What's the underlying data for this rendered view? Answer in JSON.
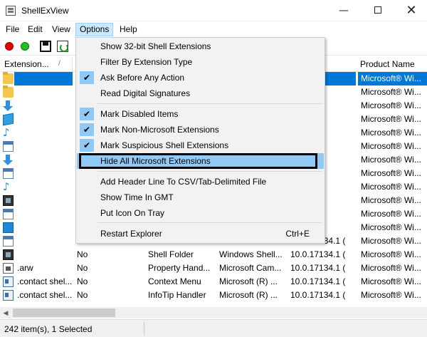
{
  "window": {
    "title": "ShellExView",
    "minimize": "—",
    "close": "✕"
  },
  "menubar": {
    "file": "File",
    "edit": "Edit",
    "view": "View",
    "options": "Options",
    "help": "Help"
  },
  "list": {
    "headers": {
      "extension": "Extension...",
      "sort": "/",
      "product": "Product Name"
    },
    "rows": [
      {
        "icon": "folder-icon",
        "ext": "",
        "disabled": "",
        "type": "",
        "desc": "",
        "ver": "4.1 (",
        "prod": "Microsoft® Wi...",
        "selected": true
      },
      {
        "icon": "folder-icon",
        "ext": "",
        "disabled": "",
        "type": "",
        "desc": "",
        "ver": "4.1 (",
        "prod": "Microsoft® Wi..."
      },
      {
        "icon": "arrow-icon",
        "ext": "",
        "disabled": "",
        "type": "",
        "desc": "",
        "ver": "4.1 (",
        "prod": "Microsoft® Wi..."
      },
      {
        "icon": "cube-icon",
        "ext": "",
        "disabled": "",
        "type": "",
        "desc": "",
        "ver": "4.1 (",
        "prod": "Microsoft® Wi..."
      },
      {
        "icon": "music-note-icon",
        "ext": "",
        "disabled": "",
        "type": "",
        "desc": "",
        "ver": "4.1 (",
        "prod": "Microsoft® Wi..."
      },
      {
        "icon": "window-icon",
        "ext": "",
        "disabled": "",
        "type": "",
        "desc": "",
        "ver": "4.1 (",
        "prod": "Microsoft® Wi..."
      },
      {
        "icon": "arrow-icon",
        "ext": "",
        "disabled": "",
        "type": "",
        "desc": "",
        "ver": "4.1 (",
        "prod": "Microsoft® Wi..."
      },
      {
        "icon": "window-icon",
        "ext": "",
        "disabled": "",
        "type": "",
        "desc": "",
        "ver": "4.1 (",
        "prod": "Microsoft® Wi..."
      },
      {
        "icon": "music-note-icon",
        "ext": "",
        "disabled": "",
        "type": "",
        "desc": "",
        "ver": "4.1 (",
        "prod": "Microsoft® Wi..."
      },
      {
        "icon": "film-icon",
        "ext": "",
        "disabled": "",
        "type": "",
        "desc": "",
        "ver": "4.1 (",
        "prod": "Microsoft® Wi..."
      },
      {
        "icon": "window-icon",
        "ext": "",
        "disabled": "",
        "type": "",
        "desc": "",
        "ver": "4.1 (",
        "prod": "Microsoft® Wi..."
      },
      {
        "icon": "screen-icon",
        "ext": "",
        "disabled": "",
        "type": "",
        "desc": "",
        "ver": "4.1 (",
        "prod": "Microsoft® Wi..."
      },
      {
        "icon": "window-icon",
        "ext": "",
        "disabled": "No",
        "type": "Shell Folder",
        "desc": "Windows Shell...",
        "ver": "10.0.17134.1 (",
        "prod": "Microsoft® Wi..."
      },
      {
        "icon": "film-icon",
        "ext": "",
        "disabled": "No",
        "type": "Shell Folder",
        "desc": "Windows Shell...",
        "ver": "10.0.17134.1 (",
        "prod": "Microsoft® Wi..."
      },
      {
        "icon": "document-icon",
        "ext": ".arw",
        "disabled": "No",
        "type": "Property Hand...",
        "desc": "Microsoft Cam...",
        "ver": "10.0.17134.1 (",
        "prod": "Microsoft® Wi..."
      },
      {
        "icon": "contact-card-icon",
        "ext": ".contact shel...",
        "disabled": "No",
        "type": "Context Menu",
        "desc": "Microsoft (R) ...",
        "ver": "10.0.17134.1 (",
        "prod": "Microsoft® Wi..."
      },
      {
        "icon": "contact-card-icon",
        "ext": ".contact shel...",
        "disabled": "No",
        "type": "InfoTip Handler",
        "desc": "Microsoft (R) ...",
        "ver": "10.0.17134.1 (",
        "prod": "Microsoft® Wi..."
      }
    ]
  },
  "options_menu": {
    "items": [
      {
        "label": "Show 32-bit Shell Extensions",
        "checked": false
      },
      {
        "label": "Filter By Extension Type",
        "checked": false
      },
      {
        "label": "Ask Before Any Action",
        "checked": true
      },
      {
        "label": "Read Digital Signatures",
        "checked": false
      },
      {
        "label": "Mark Disabled Items",
        "checked": true
      },
      {
        "label": "Mark Non-Microsoft Extensions",
        "checked": true
      },
      {
        "label": "Mark Suspicious Shell Extensions",
        "checked": true
      },
      {
        "label": "Hide All Microsoft Extensions",
        "checked": false,
        "highlighted": true
      },
      {
        "label": "Add Header Line To CSV/Tab-Delimited File",
        "checked": false
      },
      {
        "label": "Show Time In GMT",
        "checked": false
      },
      {
        "label": "Put Icon On Tray",
        "checked": false
      },
      {
        "label": "Restart Explorer",
        "checked": false,
        "shortcut": "Ctrl+E"
      }
    ],
    "check_glyph": "✔"
  },
  "status": {
    "text": "242 item(s), 1 Selected"
  },
  "colors": {
    "selection": "#0078d7",
    "menu_highlight": "#91c9f7",
    "menu_open": "#cce8ff"
  }
}
